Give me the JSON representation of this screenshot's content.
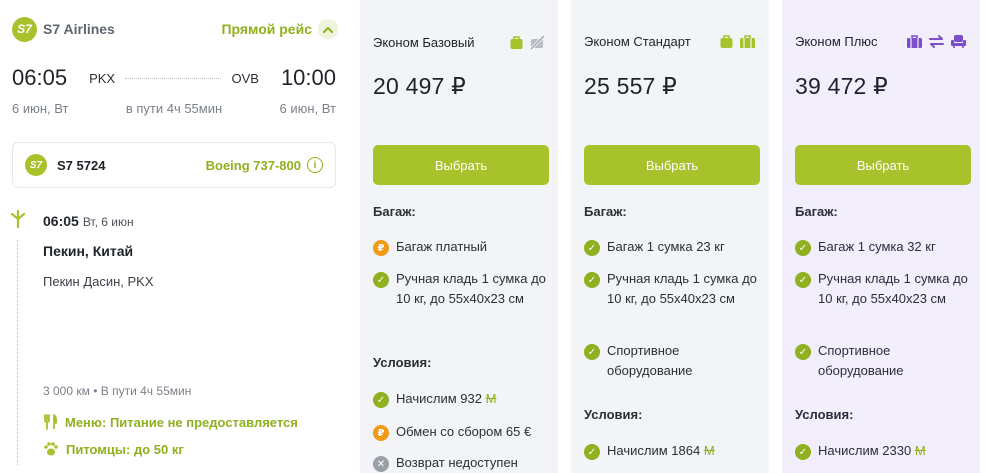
{
  "flight": {
    "airline": "S7 Airlines",
    "direct_label": "Прямой рейс",
    "dep_time": "06:05",
    "arr_time": "10:00",
    "dep_code": "PKX",
    "arr_code": "OVB",
    "dep_date": "6 июн, Вт",
    "arr_date": "6 июн, Вт",
    "duration": "в пути 4ч 55мин",
    "flight_number": "S7 5724",
    "aircraft": "Boeing 737-800",
    "logo_text": "S7",
    "segment": {
      "time": "06:05",
      "date": "Вт, 6 июн",
      "city": "Пекин, Китай",
      "airport": "Пекин Дасин, PKX",
      "distance": "3 000 км",
      "bullet": "•",
      "travel_time": "В пути 4ч 55мин",
      "meal": "Меню: Питание не предоставляется",
      "pets": "Питомцы: до 50 кг"
    }
  },
  "fares": [
    {
      "name": "Эконом Базовый",
      "price": "20 497 ₽",
      "button": "Выбрать",
      "baggage_title": "Багаж:",
      "baggage": [
        {
          "status": "paid",
          "text": "Багаж платный"
        },
        {
          "status": "ok",
          "text": "Ручная кладь 1 сумка до 10 кг, до 55x40x23 см"
        }
      ],
      "conditions_title": "Условия:",
      "conditions": [
        {
          "status": "ok",
          "text": "Начислим 932",
          "mile": "M"
        },
        {
          "status": "paid",
          "text": "Обмен со сбором 65 €",
          "mile": ""
        },
        {
          "status": "no",
          "text": "Возврат недоступен",
          "mile": ""
        }
      ]
    },
    {
      "name": "Эконом Стандарт",
      "price": "25 557 ₽",
      "button": "Выбрать",
      "baggage_title": "Багаж:",
      "baggage": [
        {
          "status": "ok",
          "text": "Багаж 1 сумка 23 кг"
        },
        {
          "status": "ok",
          "text": "Ручная кладь 1 сумка до 10 кг, до 55x40x23 см"
        },
        {
          "status": "ok",
          "text": "Спортивное оборудование"
        }
      ],
      "conditions_title": "Условия:",
      "conditions": [
        {
          "status": "ok",
          "text": "Начислим 1864",
          "mile": "M"
        }
      ]
    },
    {
      "name": "Эконом Плюс",
      "price": "39 472 ₽",
      "button": "Выбрать",
      "baggage_title": "Багаж:",
      "baggage": [
        {
          "status": "ok",
          "text": "Багаж 1 сумка 32 кг"
        },
        {
          "status": "ok",
          "text": "Ручная кладь 1 сумка до 10 кг, до 55x40x23 см"
        },
        {
          "status": "ok",
          "text": "Спортивное оборудование"
        }
      ],
      "conditions_title": "Условия:",
      "conditions": [
        {
          "status": "ok",
          "text": "Начислим 2330",
          "mile": "M"
        }
      ]
    }
  ],
  "colors": {
    "accent": "#a7c22b",
    "accent_text": "#8fb01f",
    "paid": "#f09a16",
    "unavailable": "#9aa0a8",
    "plus_icons": "#7b4fc9",
    "card_bg": "#f3f4f7",
    "plus_card_bg": "#f2eefb"
  }
}
